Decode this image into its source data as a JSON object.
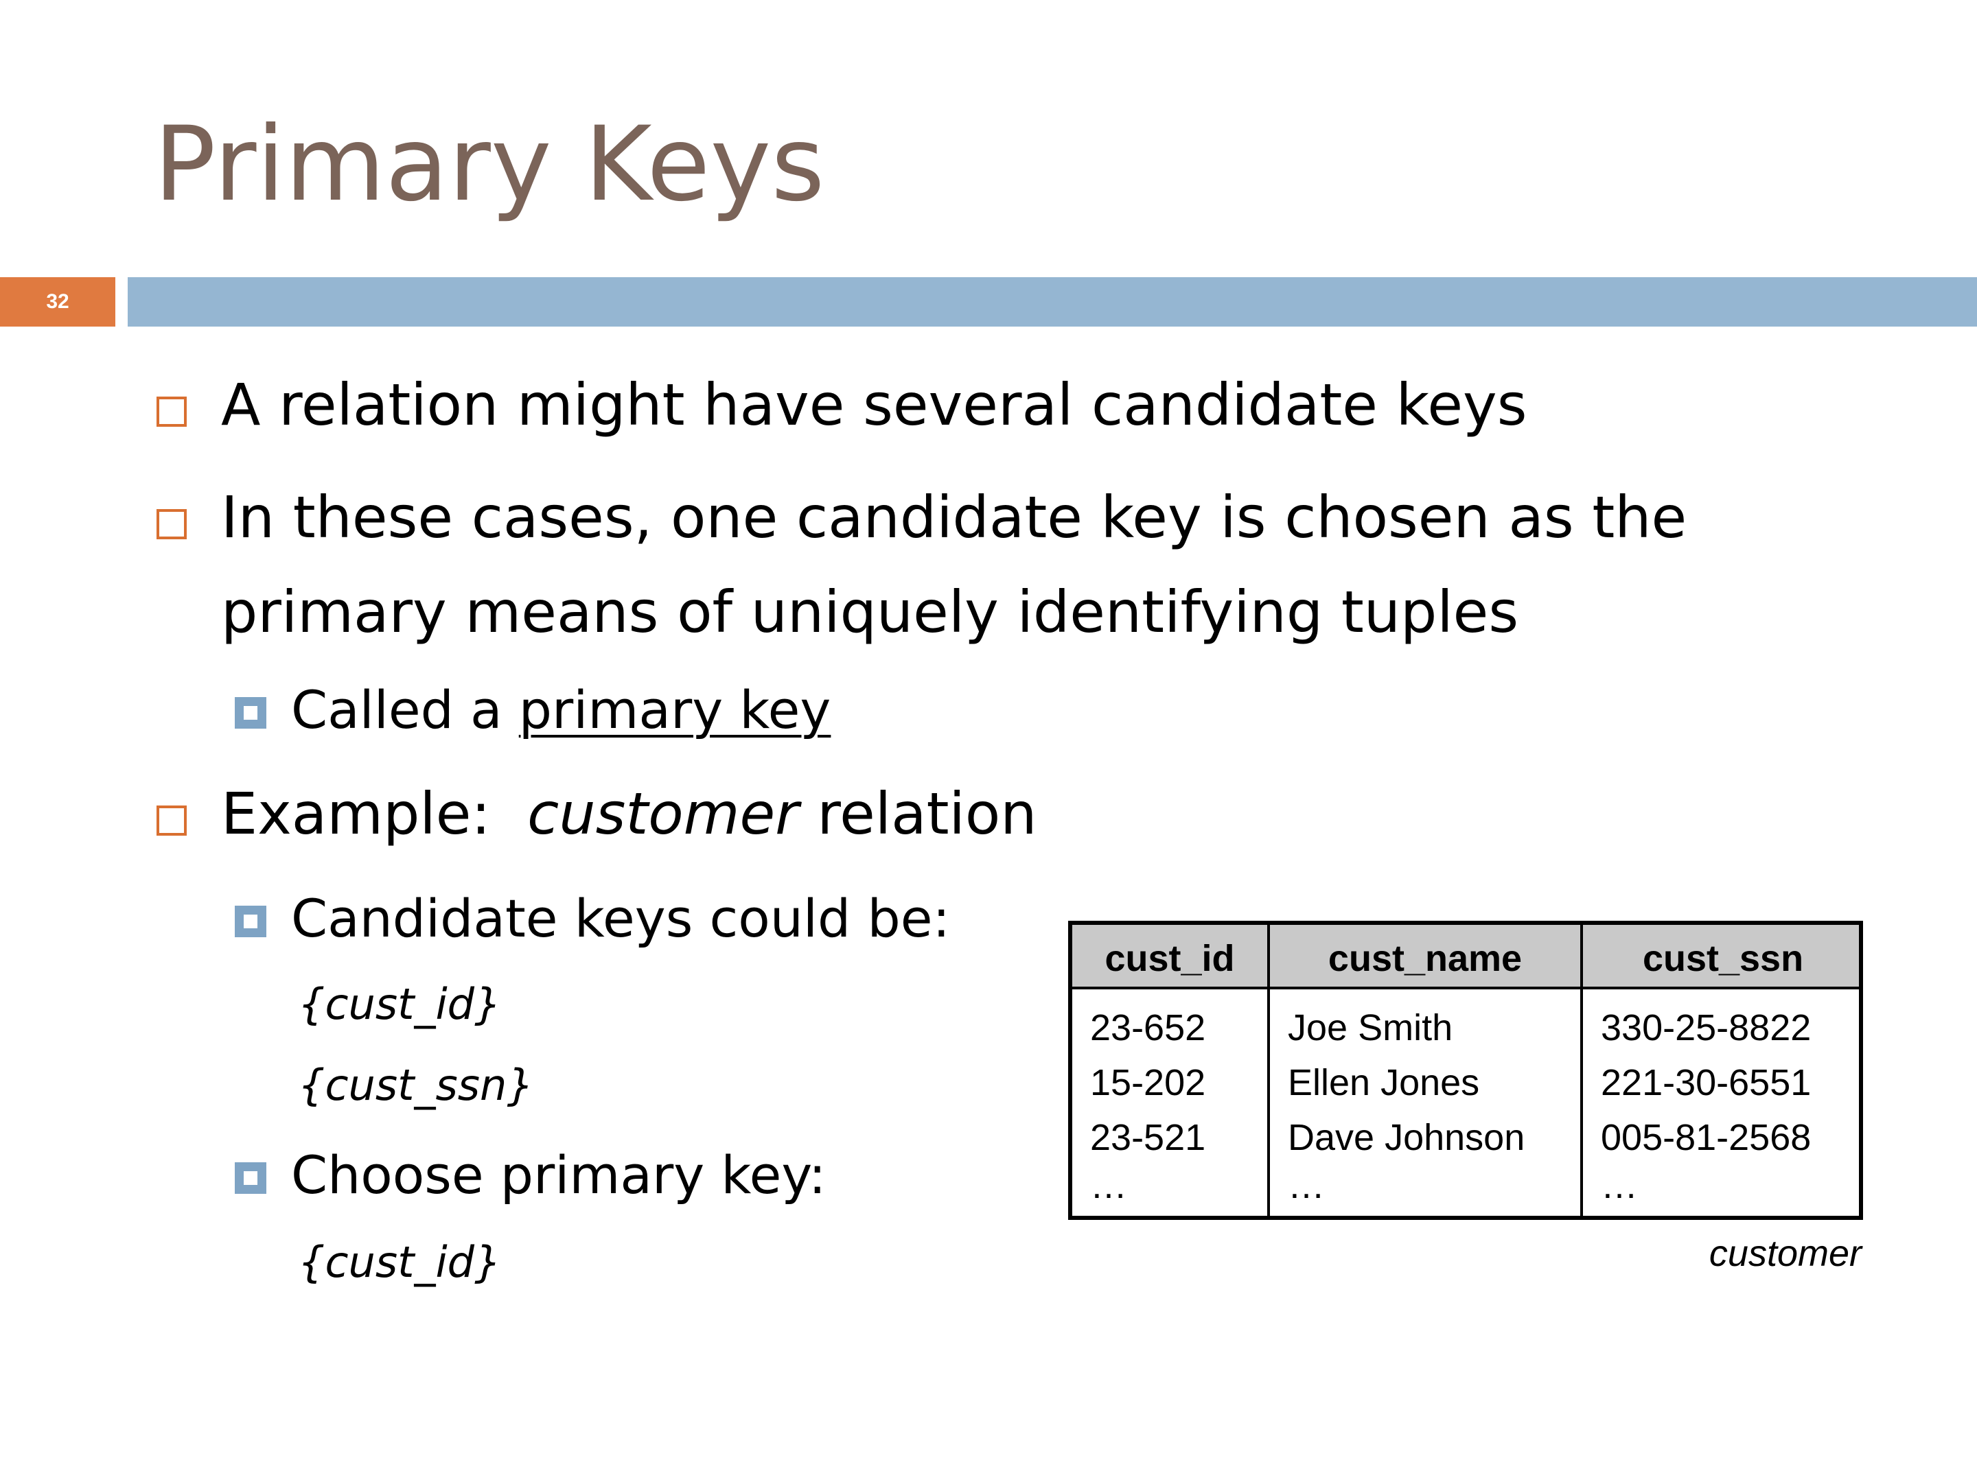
{
  "slide": {
    "title": "Primary Keys",
    "number": "32"
  },
  "bullets": {
    "b1": "A relation might have several candidate keys",
    "b2_line1": "In these cases, one candidate key is chosen as the",
    "b2_line2": "primary means of uniquely identifying tuples",
    "b2_sub_prefix": "Called a ",
    "b2_sub_term": "primary key",
    "b3_prefix": "Example:  ",
    "b3_italic": "customer",
    "b3_suffix": " relation",
    "b3_sub1": "Candidate keys could be:",
    "b3_sub1_keys": [
      "{cust_id}",
      "{cust_ssn}"
    ],
    "b3_sub2": "Choose primary key:",
    "b3_sub2_key": "{cust_id}"
  },
  "table": {
    "columns": [
      "cust_id",
      "cust_name",
      "cust_ssn"
    ],
    "rows": [
      [
        "23-652",
        "Joe Smith",
        "330-25-8822"
      ],
      [
        "15-202",
        "Ellen Jones",
        "221-30-6551"
      ],
      [
        "23-521",
        "Dave Johnson",
        "005-81-2568"
      ],
      [
        "…",
        "…",
        "…"
      ]
    ],
    "caption": "customer"
  }
}
